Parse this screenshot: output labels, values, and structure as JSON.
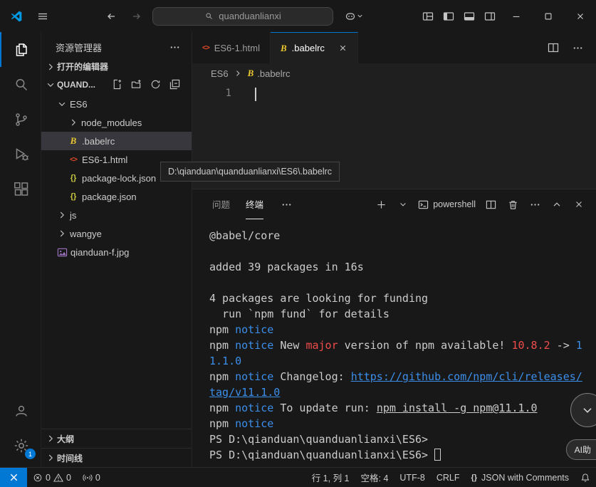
{
  "titlebar": {
    "search_value": "quanduanlianxi"
  },
  "icons": {
    "babel": "B",
    "html": "<>",
    "json": "{}",
    "braces": "{}"
  },
  "sidebar": {
    "title": "资源管理器",
    "open_editors_label": "打开的编辑器",
    "workspace_label": "QUAND...",
    "outline_label": "大纲",
    "timeline_label": "时间线",
    "tree": [
      {
        "label": "ES6",
        "type": "folder",
        "expanded": true,
        "depth": 0
      },
      {
        "label": "node_modules",
        "type": "folder",
        "expanded": false,
        "depth": 1
      },
      {
        "label": ".babelrc",
        "type": "babel",
        "depth": 1,
        "selected": true
      },
      {
        "label": "ES6-1.html",
        "type": "html",
        "depth": 1
      },
      {
        "label": "package-lock.json",
        "type": "json",
        "depth": 1
      },
      {
        "label": "package.json",
        "type": "json",
        "depth": 1
      },
      {
        "label": "js",
        "type": "folder",
        "expanded": false,
        "depth": 0
      },
      {
        "label": "wangye",
        "type": "folder",
        "expanded": false,
        "depth": 0
      },
      {
        "label": "qianduan-f.jpg",
        "type": "image",
        "depth": 0
      }
    ]
  },
  "editor": {
    "tabs": [
      {
        "label": "ES6-1.html"
      },
      {
        "label": ".babelrc"
      }
    ],
    "breadcrumb": {
      "folder": "ES6",
      "file": ".babelrc"
    },
    "line_number": "1",
    "tooltip": "D:\\qianduan\\quanduanlianxi\\ES6\\.babelrc"
  },
  "panel": {
    "problems_label": "问题",
    "terminal_label": "终端",
    "shell_label": "powershell",
    "terminal_lines": [
      [
        {
          "t": "@babel/core"
        }
      ],
      [],
      [
        {
          "t": "added 39 packages in 16s"
        }
      ],
      [],
      [
        {
          "t": "4 packages are looking for funding"
        }
      ],
      [
        {
          "t": "  run `npm fund` for details"
        }
      ],
      [
        {
          "t": "npm "
        },
        {
          "t": "notice",
          "c": "blue"
        }
      ],
      [
        {
          "t": "npm "
        },
        {
          "t": "notice",
          "c": "blue"
        },
        {
          "t": " New "
        },
        {
          "t": "major",
          "c": "red"
        },
        {
          "t": " version of npm available! "
        },
        {
          "t": "10.8.2",
          "c": "red"
        },
        {
          "t": " -> "
        },
        {
          "t": "1",
          "c": "blue"
        }
      ],
      [
        {
          "t": "1.1.0",
          "c": "blue"
        }
      ],
      [
        {
          "t": "npm "
        },
        {
          "t": "notice",
          "c": "blue"
        },
        {
          "t": " Changelog: "
        },
        {
          "t": "https://github.com/npm/cli/releases/",
          "c": "link"
        }
      ],
      [
        {
          "t": "tag/v11.1.0",
          "c": "link"
        }
      ],
      [
        {
          "t": "npm "
        },
        {
          "t": "notice",
          "c": "blue"
        },
        {
          "t": " To update run: "
        },
        {
          "t": "npm install -g npm@11.1.0",
          "c": "underline"
        }
      ],
      [
        {
          "t": "npm "
        },
        {
          "t": "notice",
          "c": "blue"
        }
      ],
      [
        {
          "t": "PS D:\\qianduan\\quanduanlianxi\\ES6>"
        }
      ],
      [
        {
          "t": "PS D:\\qianduan\\quanduanlianxi\\ES6> "
        },
        {
          "t": "",
          "c": "cursor"
        }
      ]
    ]
  },
  "statusbar": {
    "errors": "0",
    "warnings": "0",
    "ports": "0",
    "cursor_position": "行 1, 列 1",
    "indentation": "空格: 4",
    "encoding": "UTF-8",
    "eol": "CRLF",
    "language": "JSON with Comments"
  },
  "activitybar": {
    "settings_badge": "1"
  },
  "floating": {
    "ai_label": "AI助"
  }
}
